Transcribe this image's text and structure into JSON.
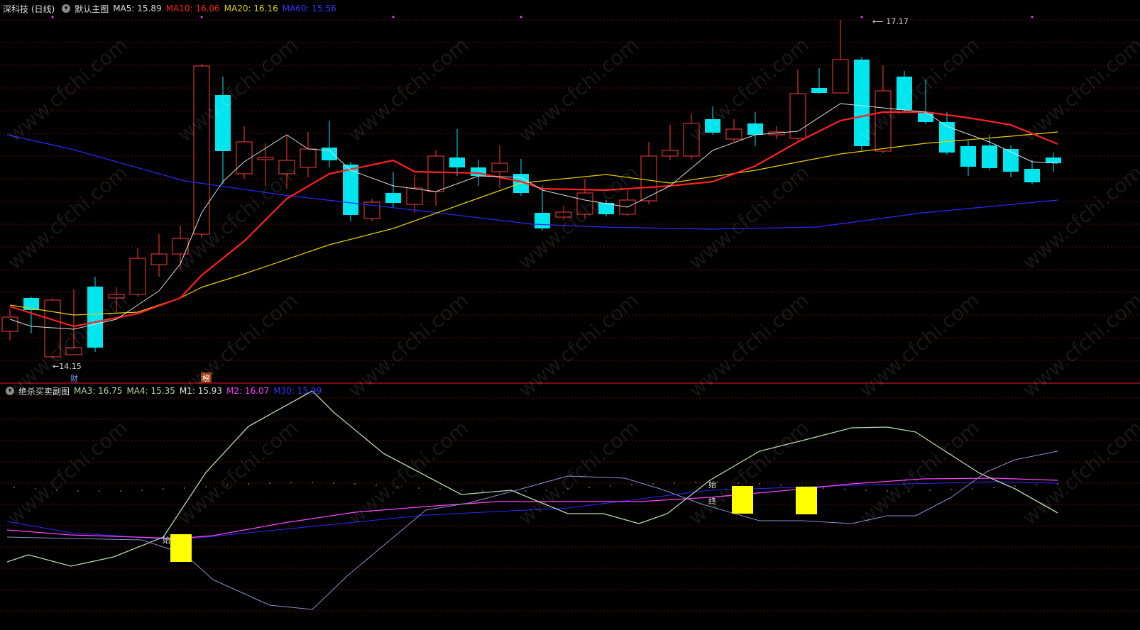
{
  "main": {
    "title": "深科技 (日线)",
    "indicator_name": "默认主图",
    "ma5": "MA5: 15.89",
    "ma10": "MA10: 16.06",
    "ma20": "MA20: 16.16",
    "ma60": "MA60: 15.56",
    "high_label": "17.17",
    "low_label": "14.15",
    "badge_cai": "财",
    "badge_bang": "榜"
  },
  "sub": {
    "indicator_name": "绝杀买卖副图",
    "ma3": "MA3: 16.75",
    "ma4": "MA4: 15.35",
    "m1": "M1: 15.93",
    "m2": "M2: 16.07",
    "m30": "M30: 15.99",
    "start_label": "始",
    "end_label": "终"
  },
  "watermark": "www.cfchi.com",
  "colors": {
    "up": "#ff3b3b",
    "down": "#00e5ee",
    "ma5": "#dddddd",
    "ma10": "#ff2020",
    "ma20": "#e6d200",
    "ma60": "#2a2aff",
    "ma3": "#b8d8a8",
    "ma4": "#8890c8",
    "m2": "#ff40ff",
    "signal": "#ffff00"
  },
  "chart_data": {
    "type": "candlestick",
    "price_high": 17.17,
    "price_low": 14.15,
    "candle_count": 50
  }
}
